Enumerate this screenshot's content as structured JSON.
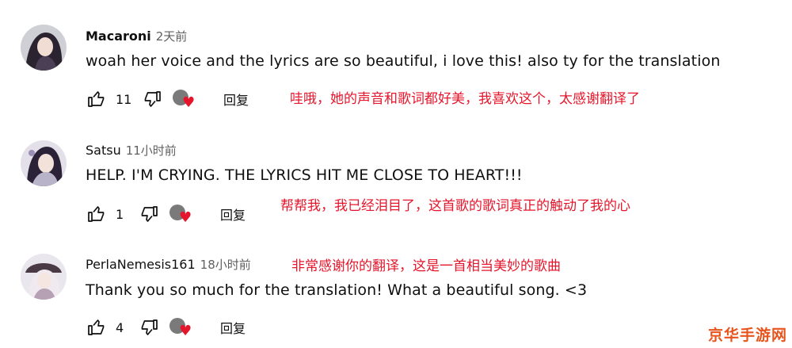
{
  "comments": [
    {
      "author": "Macaroni",
      "time": "2天前",
      "text": "woah her voice and the lyrics are so beautiful, i love this! also ty for the translation",
      "likes": "11",
      "reply_label": "回复",
      "translation": "哇哦，她的声音和歌词都好美，我喜欢这个，太感谢翻译了",
      "avatar_icon": "anime-avatar-icon"
    },
    {
      "author": "Satsu",
      "time": "11小时前",
      "text": "HELP. I'M CRYING. THE LYRICS HIT ME CLOSE TO HEART!!!",
      "likes": "1",
      "reply_label": "回复",
      "translation": "帮帮我，我已经泪目了，这首歌的歌词真正的触动了我的心",
      "avatar_icon": "anime-avatar-icon"
    },
    {
      "author": "PerlaNemesis161",
      "time": "18小时前",
      "text": "Thank you so much for the translation! What a beautiful song. <3",
      "likes": "4",
      "reply_label": "回复",
      "translation": "非常感谢你的翻译，这是一首相当美妙的歌曲",
      "avatar_icon": "anime-avatar-icon"
    }
  ],
  "watermark": "京华手游网",
  "colors": {
    "translation": "#e5162b",
    "heart": "#e5162b",
    "watermark": "#e7541d",
    "secondary_text": "#606060"
  }
}
